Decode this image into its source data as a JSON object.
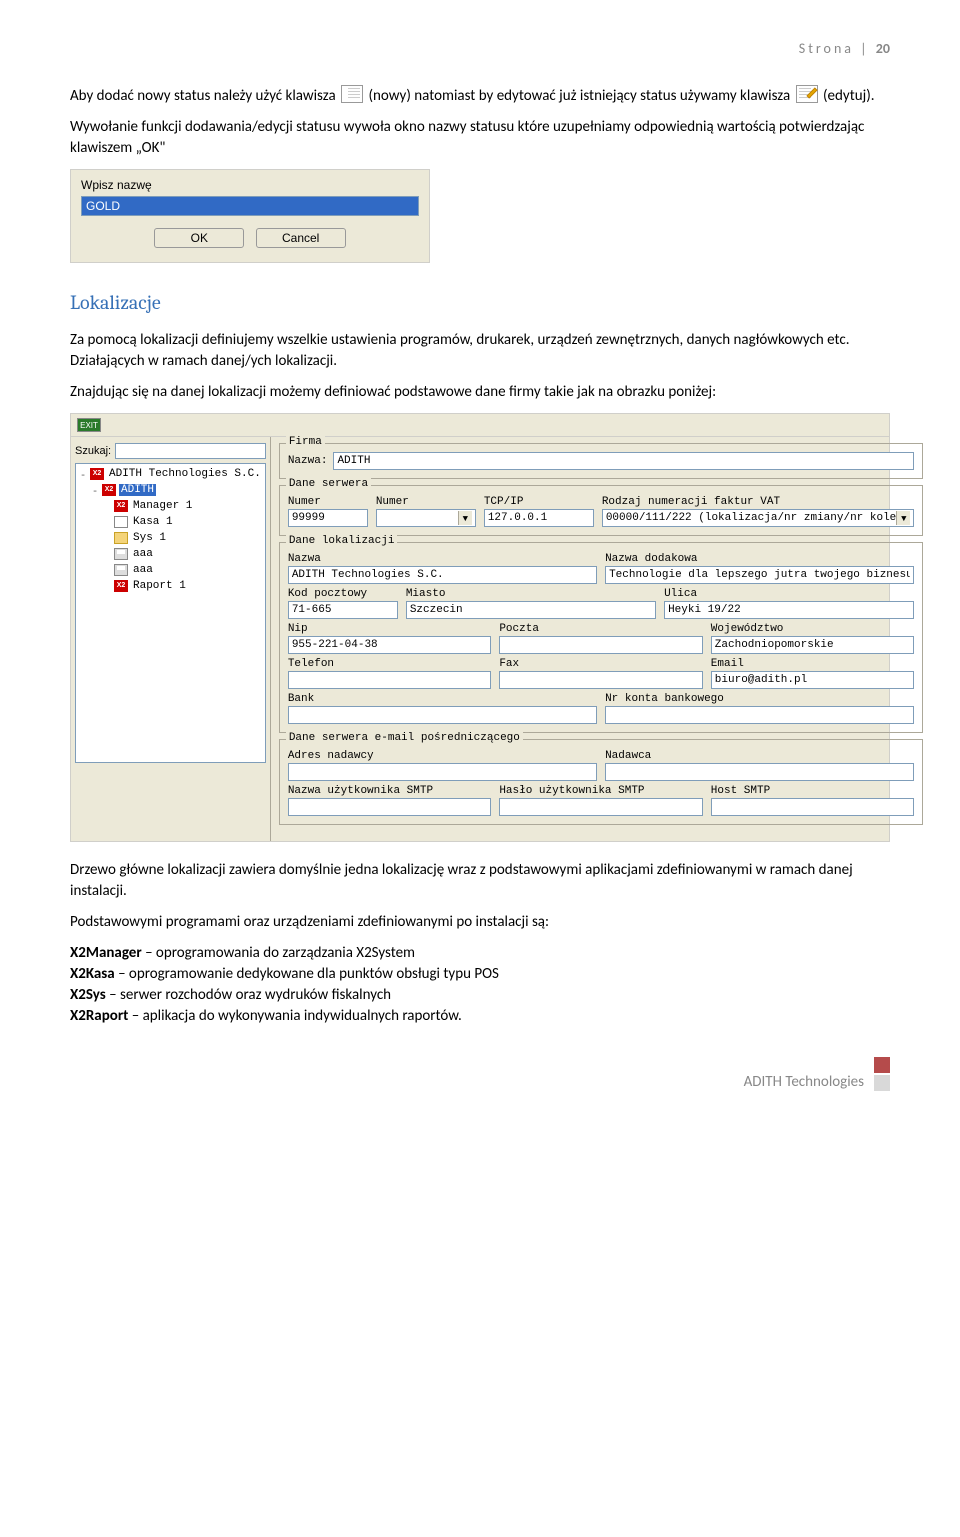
{
  "page_header": {
    "label": "Strona |",
    "num": "20"
  },
  "intro": {
    "p1_a": "Aby dodać nowy status należy użyć klawisza",
    "p1_b": "(nowy) natomiast by edytować już istniejący status używamy klawisza",
    "p1_c": "(edytuj).",
    "p2": "Wywołanie funkcji dodawania/edycji statusu wywoła okno nazwy statusu które uzupełniamy odpowiednią wartością potwierdzając klawiszem „OK\""
  },
  "dialog": {
    "label": "Wpisz nazwę",
    "value": "GOLD",
    "ok": "OK",
    "cancel": "Cancel"
  },
  "section_title": "Lokalizacje",
  "loc_p1": "Za pomocą lokalizacji definiujemy wszelkie ustawienia programów, drukarek, urządzeń zewnętrznych, danych nagłówkowych etc. Działających w ramach danej/ych lokalizacji.",
  "loc_p2": "Znajdując się na danej lokalizacji możemy definiować podstawowe dane firmy takie jak na obrazku poniżej:",
  "panel": {
    "exit": "EXIT",
    "search_label": "Szukaj:",
    "search_value": "",
    "tree": [
      {
        "icon": "x2",
        "label": "ADITH Technologies S.C.",
        "depth": 0,
        "toggle": "-"
      },
      {
        "icon": "x2",
        "label": "ADITH",
        "depth": 1,
        "toggle": "-",
        "selected": true
      },
      {
        "icon": "x2",
        "label": "Manager 1",
        "depth": 2
      },
      {
        "icon": "doc",
        "label": "Kasa 1",
        "depth": 2
      },
      {
        "icon": "folder",
        "label": "Sys 1",
        "depth": 2
      },
      {
        "icon": "prn",
        "label": "aaa",
        "depth": 2
      },
      {
        "icon": "prn",
        "label": "aaa",
        "depth": 2
      },
      {
        "icon": "x2",
        "label": "Raport 1",
        "depth": 2
      }
    ],
    "firma": {
      "title": "Firma",
      "nazwa_label": "Nazwa:",
      "nazwa_value": "ADITH"
    },
    "serwer": {
      "title": "Dane serwera",
      "numer1_label": "Numer",
      "numer1_value": "99999",
      "numer2_label": "Numer",
      "numer2_value": "",
      "tcpip_label": "TCP/IP",
      "tcpip_value": "127.0.0.1",
      "vat_label": "Rodzaj numeracji faktur VAT",
      "vat_value": "00000/111/222 (lokalizacja/nr zmiany/nr kole"
    },
    "lokal": {
      "title": "Dane lokalizacji",
      "nazwa_label": "Nazwa",
      "nazwa_value": "ADITH Technologies S.C.",
      "nazwa_dod_label": "Nazwa dodakowa",
      "nazwa_dod_value": "Technologie dla lepszego jutra twojego biznesu",
      "kod_label": "Kod pocztowy",
      "kod_value": "71-665",
      "miasto_label": "Miasto",
      "miasto_value": "Szczecin",
      "ulica_label": "Ulica",
      "ulica_value": "Heyki 19/22",
      "nip_label": "Nip",
      "nip_value": "955-221-04-38",
      "poczta_label": "Poczta",
      "poczta_value": "",
      "woj_label": "Województwo",
      "woj_value": "Zachodniopomorskie",
      "tel_label": "Telefon",
      "tel_value": "",
      "fax_label": "Fax",
      "fax_value": "",
      "email_label": "Email",
      "email_value": "biuro@adith.pl",
      "bank_label": "Bank",
      "bank_value": "",
      "konto_label": "Nr konta bankowego",
      "konto_value": ""
    },
    "smtp": {
      "title": "Dane serwera e-mail pośredniczącego",
      "adres_label": "Adres nadawcy",
      "adres_value": "",
      "nadawca_label": "Nadawca",
      "nadawca_value": "",
      "user_label": "Nazwa użytkownika SMTP",
      "user_value": "",
      "pass_label": "Hasło użytkownika SMTP",
      "pass_value": "",
      "host_label": "Host SMTP",
      "host_value": ""
    }
  },
  "after_p1": "Drzewo główne lokalizacji zawiera domyślnie jedna lokalizację wraz z podstawowymi aplikacjami zdefiniowanymi w ramach danej instalacji.",
  "after_p2": "Podstawowymi programami oraz urządzeniami zdefiniowanymi po instalacji są:",
  "apps": {
    "l1a": "X2Manager",
    "l1b": " – oprogramowania do zarządzania X2System",
    "l2a": "X2Kasa",
    "l2b": " – oprogramowanie dedykowane dla punktów obsługi typu POS",
    "l3a": "X2Sys",
    "l3b": " – serwer rozchodów oraz wydruków fiskalnych",
    "l4a": "X2Raport",
    "l4b": " – aplikacja do wykonywania indywidualnych raportów."
  },
  "footer": "ADITH Technologies"
}
